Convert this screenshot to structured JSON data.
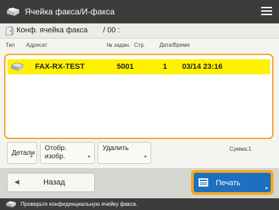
{
  "titlebar": {
    "icon": "fax-machine-icon",
    "title": "Ячейка факса/И-факса",
    "menu_icon": "hamburger-menu-icon"
  },
  "box": {
    "icon": "confidential-box-icon",
    "label": "Конф. ячейка факса",
    "count": "/ 00 :"
  },
  "columns": {
    "type": "Тип",
    "address": "Адресат",
    "job": "№ задан.",
    "pages": "Стр.",
    "datetime": "Дата/Время"
  },
  "rows": [
    {
      "type_icon": "fax-machine-icon",
      "address": "FAX-RX-TEST",
      "job": "5001",
      "pages": "1",
      "datetime": "03/14  23:16",
      "selected": true
    }
  ],
  "actions": {
    "details": "Детали",
    "preview_line1": "Отобр.",
    "preview_line2": "изобр.",
    "delete": "Удалить",
    "sum": "Сумма:1"
  },
  "bottom": {
    "back": "Назад",
    "print": "Печать"
  },
  "status": {
    "icon": "fax-machine-icon",
    "text": "Проверьте конфиденциальную ячейку факса."
  },
  "colors": {
    "selection": "#fff200",
    "focus_border": "#f5a623",
    "primary": "#1d6fc0",
    "bar_dark": "#3c3c3c"
  }
}
